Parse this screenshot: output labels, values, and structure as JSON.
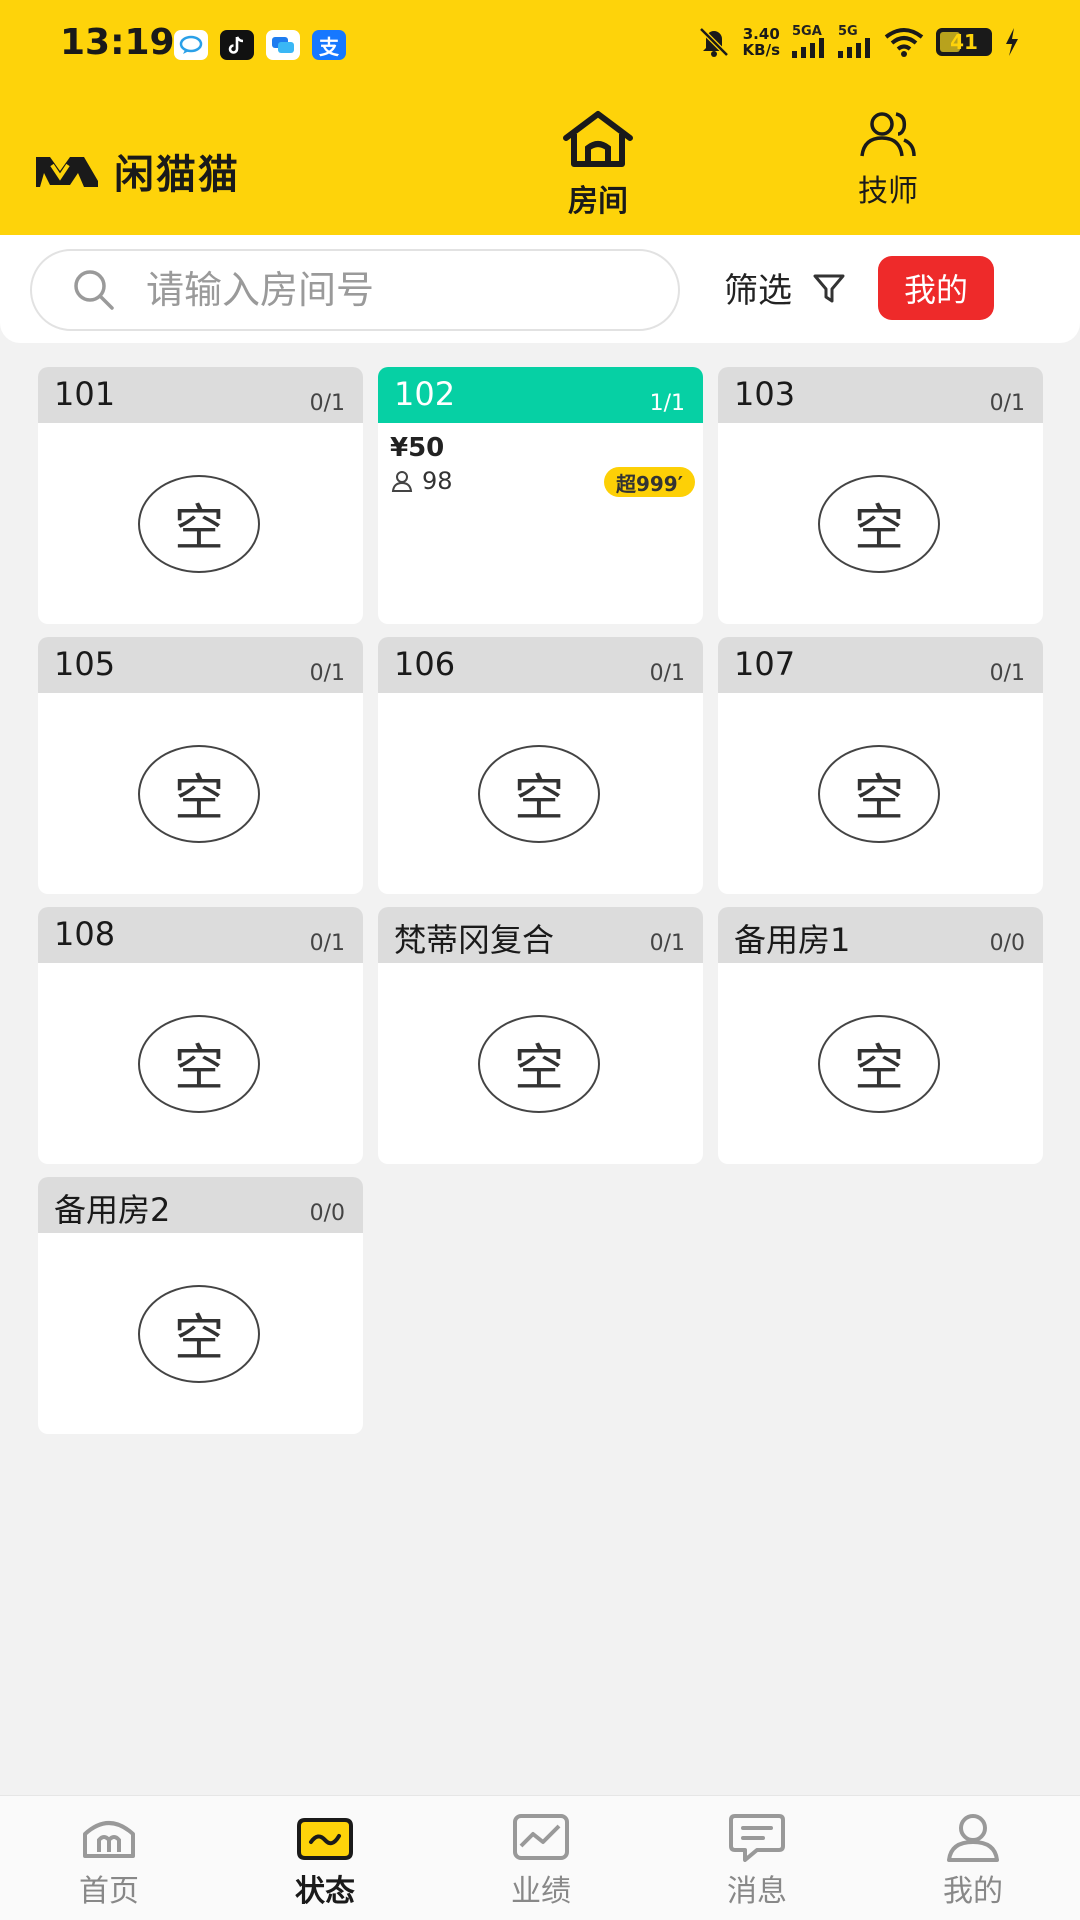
{
  "status_bar": {
    "time": "13:19",
    "net_speed_value": "3.40",
    "net_speed_unit": "KB/s",
    "sim1_label": "5GA",
    "sim2_label": "5G",
    "battery": "41",
    "battery_level": 0.41,
    "notif_apps": [
      "chat-bubble-icon",
      "tiktok-icon",
      "messages-icon",
      "alipay-icon"
    ],
    "alipay_glyph": "支"
  },
  "header": {
    "brand_name": "闲猫猫",
    "tabs": [
      {
        "label": "房间",
        "icon": "home-icon",
        "active": true
      },
      {
        "label": "技师",
        "icon": "users-icon",
        "active": false
      }
    ]
  },
  "search": {
    "placeholder": "请输入房间号",
    "filter_label": "筛选",
    "mine_label": "我的"
  },
  "rooms": [
    {
      "name": "101",
      "occupancy": "0/1",
      "status_text": "空"
    },
    {
      "name": "102",
      "occupancy": "1/1",
      "price": "¥50",
      "guests": "98",
      "over_tag": "超999′"
    },
    {
      "name": "103",
      "occupancy": "0/1",
      "status_text": "空"
    },
    {
      "name": "105",
      "occupancy": "0/1",
      "status_text": "空"
    },
    {
      "name": "106",
      "occupancy": "0/1",
      "status_text": "空"
    },
    {
      "name": "107",
      "occupancy": "0/1",
      "status_text": "空"
    },
    {
      "name": "108",
      "occupancy": "0/1",
      "status_text": "空"
    },
    {
      "name": "梵蒂冈复合",
      "occupancy": "0/1",
      "status_text": "空"
    },
    {
      "name": "备用房1",
      "occupancy": "0/0",
      "status_text": "空"
    },
    {
      "name": "备用房2",
      "occupancy": "0/0",
      "status_text": "空"
    }
  ],
  "bottom_nav": [
    {
      "label": "首页",
      "icon": "home-m-icon",
      "active": false
    },
    {
      "label": "状态",
      "icon": "status-face-icon",
      "active": true
    },
    {
      "label": "业绩",
      "icon": "chart-icon",
      "active": false
    },
    {
      "label": "消息",
      "icon": "message-icon",
      "active": false
    },
    {
      "label": "我的",
      "icon": "profile-icon",
      "active": false
    }
  ],
  "colors": {
    "brand_yellow": "#fed30a",
    "busy_green": "#06d0a4",
    "mine_red": "#ee2a2a"
  }
}
